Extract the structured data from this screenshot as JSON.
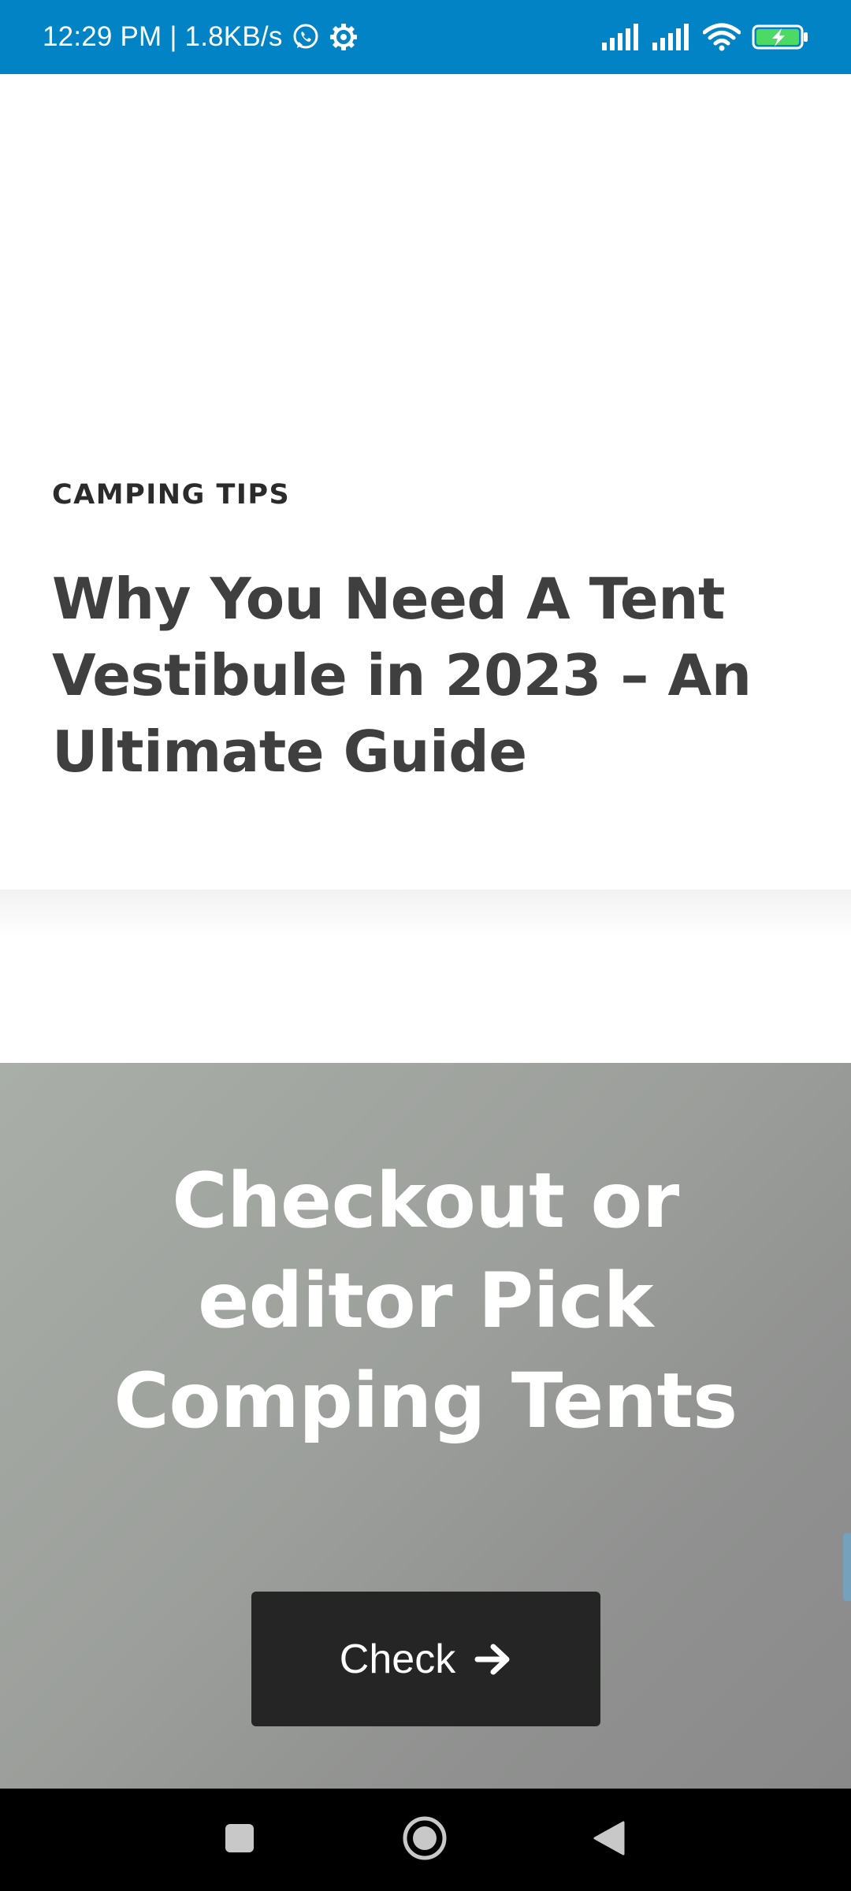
{
  "status_bar": {
    "time_speed": "12:29 PM | 1.8KB/s",
    "icons": [
      "whatsapp-icon",
      "settings-gear-icon",
      "signal-icon",
      "signal-icon",
      "wifi-icon",
      "battery-charging-icon"
    ],
    "background_color": "#0283c5"
  },
  "article": {
    "category": "CAMPING TIPS",
    "title": "Why You Need A Tent Vestibule in 2023 – An Ultimate Guide"
  },
  "promo": {
    "heading": "Checkout or editor Pick Comping Tents",
    "button_label": "Check",
    "button_icon": "arrow-right-icon",
    "button_color": "#252525"
  },
  "nav_bar": {
    "buttons": [
      "recents-icon",
      "home-icon",
      "back-icon"
    ]
  }
}
